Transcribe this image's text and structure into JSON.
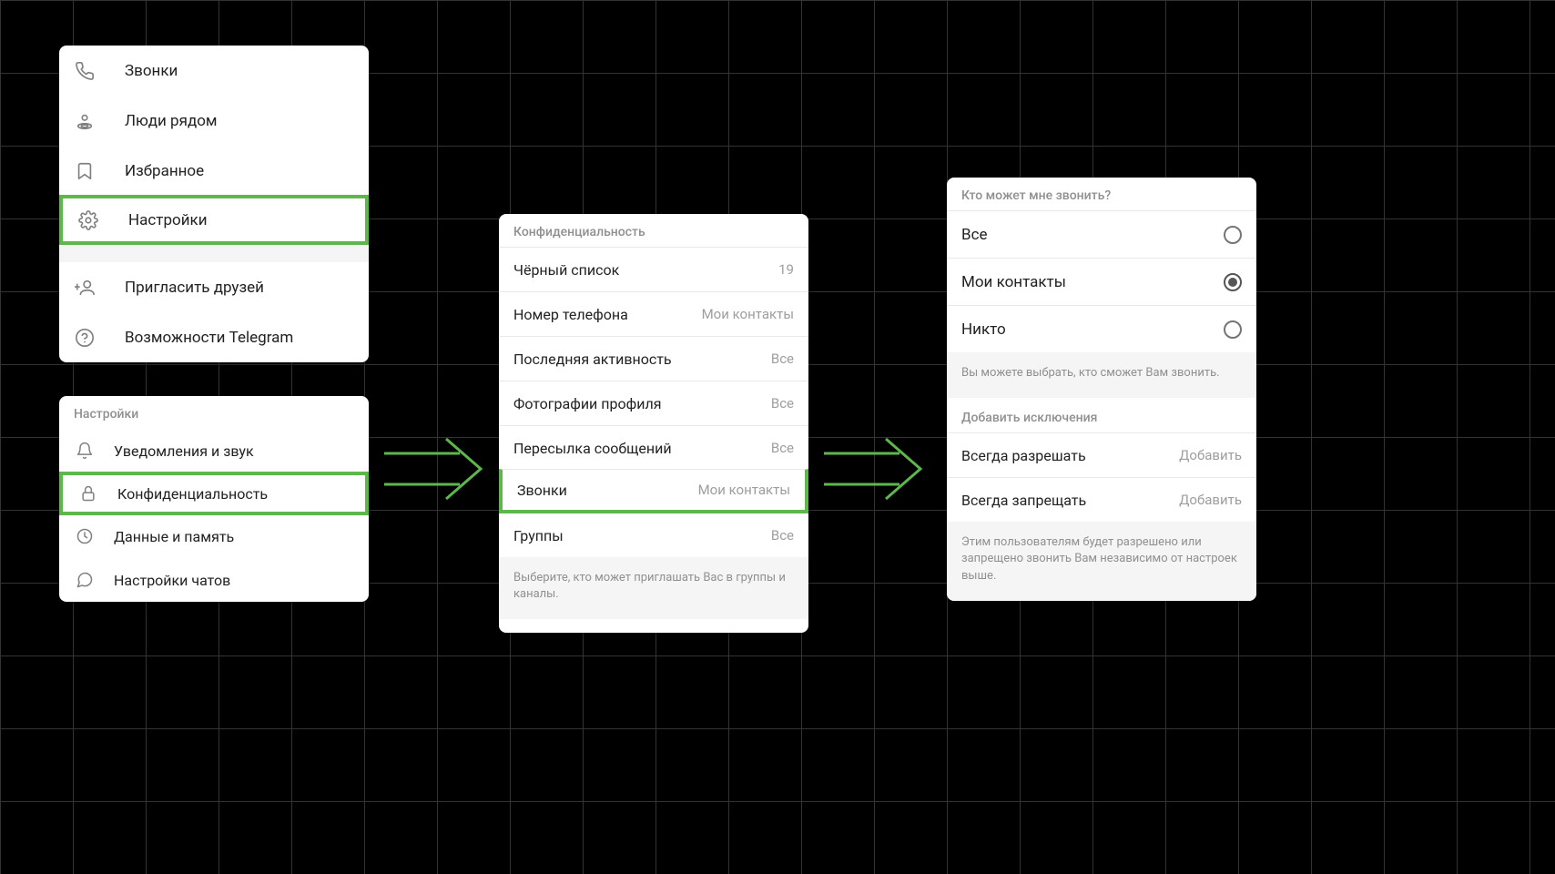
{
  "menu": {
    "items": [
      {
        "icon": "phone",
        "label": "Звонки"
      },
      {
        "icon": "nearby",
        "label": "Люди рядом"
      },
      {
        "icon": "bookmark",
        "label": "Избранное"
      },
      {
        "icon": "gear",
        "label": "Настройки",
        "highlight": true
      },
      {
        "icon": "invite",
        "label": "Пригласить друзей"
      },
      {
        "icon": "help",
        "label": "Возможности Telegram"
      }
    ]
  },
  "settings": {
    "title": "Настройки",
    "items": [
      {
        "icon": "bell",
        "label": "Уведомления и звук"
      },
      {
        "icon": "lock",
        "label": "Конфиденциальность",
        "highlight": true
      },
      {
        "icon": "data",
        "label": "Данные и память"
      },
      {
        "icon": "chat",
        "label": "Настройки чатов"
      }
    ]
  },
  "privacy": {
    "title": "Конфиденциальность",
    "rows": [
      {
        "k": "Чёрный список",
        "v": "19"
      },
      {
        "k": "Номер телефона",
        "v": "Мои контакты"
      },
      {
        "k": "Последняя активность",
        "v": "Все"
      },
      {
        "k": "Фотографии профиля",
        "v": "Все"
      },
      {
        "k": "Пересылка сообщений",
        "v": "Все"
      },
      {
        "k": "Звонки",
        "v": "Мои контакты",
        "highlight": true
      },
      {
        "k": "Группы",
        "v": "Все"
      }
    ],
    "footer": "Выберите, кто может приглашать Вас в группы и каналы."
  },
  "calls": {
    "title": "Кто может мне звонить?",
    "options": [
      {
        "label": "Все",
        "checked": false
      },
      {
        "label": "Мои контакты",
        "checked": true
      },
      {
        "label": "Никто",
        "checked": false
      }
    ],
    "hint1": "Вы можете выбрать, кто сможет Вам звонить.",
    "exceptions_title": "Добавить исключения",
    "exceptions": [
      {
        "label": "Всегда разрешать",
        "action": "Добавить"
      },
      {
        "label": "Всегда запрещать",
        "action": "Добавить"
      }
    ],
    "hint2": "Этим пользователям будет разрешено или запрещено звонить Вам независимо от настроек выше."
  }
}
